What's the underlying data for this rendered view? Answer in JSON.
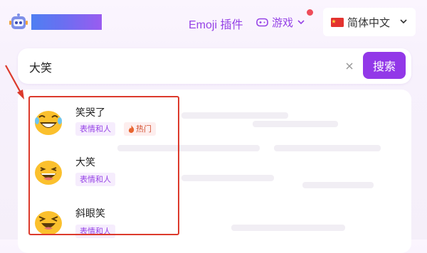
{
  "header": {
    "emoji_plugin_label": "Emoji 插件",
    "games_label": "游戏",
    "language_label": "简体中文"
  },
  "search": {
    "value": "大笑",
    "button_label": "搜索"
  },
  "results": [
    {
      "name": "笑哭了",
      "tags": [
        "表情和人"
      ],
      "hot_label": "热门"
    },
    {
      "name": "大笑",
      "tags": [
        "表情和人"
      ]
    },
    {
      "name": "斜眼笑",
      "tags": [
        "表情和人"
      ]
    }
  ],
  "colors": {
    "accent": "#9238e8",
    "highlight_border": "#dc3a2c",
    "tag_background": "#f6edfd",
    "notify_dot": "#ee4d5a"
  },
  "icons": [
    "robot-logo-icon",
    "gamepad-icon",
    "chevron-down-icon",
    "china-flag-icon",
    "clear-icon",
    "fire-icon"
  ]
}
